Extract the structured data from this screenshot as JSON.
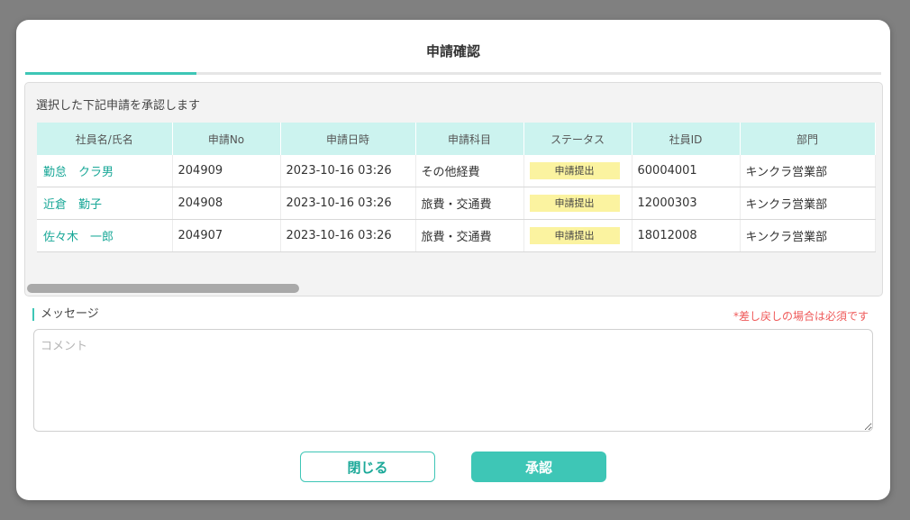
{
  "dialog": {
    "title": "申請確認"
  },
  "panel": {
    "description": "選択した下記申請を承認します"
  },
  "table": {
    "columns": [
      "社員名/氏名",
      "申請No",
      "申請日時",
      "申請科目",
      "ステータス",
      "社員ID",
      "部門"
    ],
    "rows": [
      {
        "name": "勤怠　クラ男",
        "no": "204909",
        "datetime": "2023-10-16 03:26",
        "category": "その他経費",
        "status": "申請提出",
        "employee_id": "60004001",
        "department": "キンクラ営業部"
      },
      {
        "name": "近倉　勤子",
        "no": "204908",
        "datetime": "2023-10-16 03:26",
        "category": "旅費・交通費",
        "status": "申請提出",
        "employee_id": "12000303",
        "department": "キンクラ営業部"
      },
      {
        "name": "佐々木　一郎",
        "no": "204907",
        "datetime": "2023-10-16 03:26",
        "category": "旅費・交通費",
        "status": "申請提出",
        "employee_id": "18012008",
        "department": "キンクラ営業部"
      }
    ]
  },
  "message": {
    "label": "メッセージ",
    "required_note": "*差し戻しの場合は必須です",
    "placeholder": "コメント",
    "value": ""
  },
  "buttons": {
    "close": "閉じる",
    "approve": "承認"
  },
  "colors": {
    "accent": "#3ec6b6",
    "header_bg": "#ccf3ef",
    "status_bg": "#fbf3a0",
    "required": "#ef5a5a"
  }
}
